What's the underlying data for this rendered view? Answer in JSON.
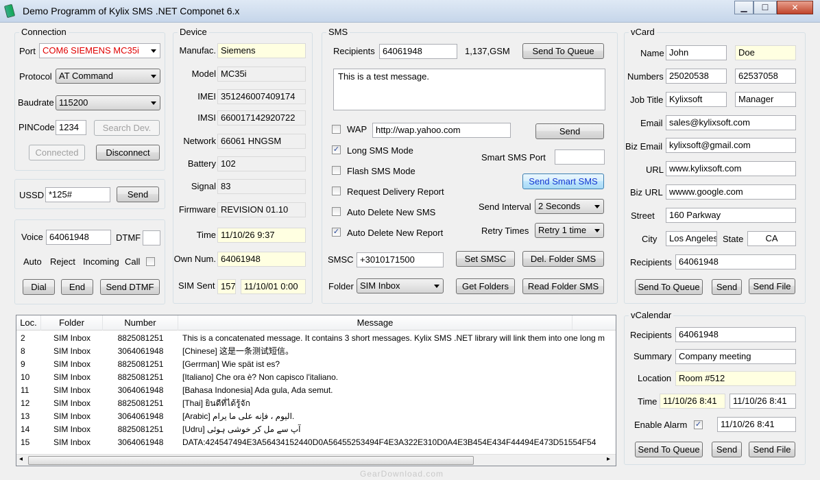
{
  "window": {
    "title": "Demo Programm of Kylix SMS .NET Componet  6.x"
  },
  "connection": {
    "group": "Connection",
    "port_label": "Port",
    "port_value": "COM6   SIEMENS MC35i",
    "protocol_label": "Protocol",
    "protocol_value": "AT Command",
    "baudrate_label": "Baudrate",
    "baudrate_value": "115200",
    "pincode_label": "PINCode",
    "pincode_value": "1234",
    "search_btn": "Search Dev.",
    "connected_btn": "Connected",
    "disconnect_btn": "Disconnect"
  },
  "ussd": {
    "label": "USSD",
    "value": "*125#",
    "send_btn": "Send"
  },
  "voice": {
    "label": "Voice",
    "value": "64061948",
    "dtmf_label": "DTMF",
    "dtmf_value": "",
    "auto": "Auto",
    "reject": "Reject",
    "incoming": "Incoming",
    "call": "Call",
    "dial_btn": "Dial",
    "end_btn": "End",
    "send_dtmf_btn": "Send DTMF"
  },
  "device": {
    "group": "Device",
    "rows": [
      {
        "label": "Manufac.",
        "value": "Siemens"
      },
      {
        "label": "Model",
        "value": "MC35i"
      },
      {
        "label": "IMEI",
        "value": "351246007409174"
      },
      {
        "label": "IMSI",
        "value": "660017142920722"
      },
      {
        "label": "Network",
        "value": "66061 HNGSM"
      },
      {
        "label": "Battery",
        "value": "102"
      },
      {
        "label": "Signal",
        "value": "83"
      },
      {
        "label": "Firmware",
        "value": "REVISION 01.10"
      },
      {
        "label": "Time",
        "value": "11/10/26 9:37"
      },
      {
        "label": "Own Num.",
        "value": "64061948"
      }
    ],
    "simsent_label": "SIM Sent",
    "simsent_count": "157",
    "simsent_time": "11/10/01 0:00"
  },
  "sms": {
    "group": "SMS",
    "recipients_label": "Recipients",
    "recipients_value": "64061948",
    "count": "1,137,GSM",
    "send_queue_btn": "Send To Queue",
    "message": "This is a test message.",
    "wap_label": "WAP",
    "wap_value": "http://wap.yahoo.com",
    "send_btn": "Send",
    "long_sms": "Long SMS Mode",
    "flash_sms": "Flash SMS Mode",
    "request_report": "Request Delivery Report",
    "auto_delete_sms": "Auto Delete New SMS",
    "auto_delete_report": "Auto Delete New Report",
    "smart_port_label": "Smart SMS Port",
    "smart_port_value": "",
    "send_smart_btn": "Send Smart SMS",
    "send_interval_label": "Send Interval",
    "send_interval_value": "2   Seconds",
    "retry_label": "Retry Times",
    "retry_value": "Retry 1 time",
    "smsc_label": "SMSC",
    "smsc_value": "+3010171500",
    "set_smsc_btn": "Set SMSC",
    "del_folder_btn": "Del. Folder SMS",
    "folder_label": "Folder",
    "folder_value": "SIM Inbox",
    "get_folders_btn": "Get Folders",
    "read_folder_btn": "Read Folder SMS"
  },
  "messages": {
    "columns": [
      "Loc.",
      "Folder",
      "Number",
      "Message"
    ],
    "rows": [
      {
        "loc": "2",
        "folder": "SIM Inbox",
        "number": "8825081251",
        "message": "This is a concatenated message. It contains 3 short messages. Kylix SMS .NET library will link them into one long m"
      },
      {
        "loc": "8",
        "folder": "SIM Inbox",
        "number": "3064061948",
        "message": "[Chinese] 这是一条测试短信。"
      },
      {
        "loc": "9",
        "folder": "SIM Inbox",
        "number": "8825081251",
        "message": "[Gerrman] Wie spät ist es?"
      },
      {
        "loc": "10",
        "folder": "SIM Inbox",
        "number": "8825081251",
        "message": "[Italiano] Che ora è? Non capisco l'italiano."
      },
      {
        "loc": "11",
        "folder": "SIM Inbox",
        "number": "3064061948",
        "message": "[Bahasa Indonesia] Ada gula, Ada semut."
      },
      {
        "loc": "12",
        "folder": "SIM Inbox",
        "number": "8825081251",
        "message": "[Thai] ยินดีที่ได้รู้จัก"
      },
      {
        "loc": "13",
        "folder": "SIM Inbox",
        "number": "3064061948",
        "message": "[Arabic] اليوم ، فإنه على ما يرام."
      },
      {
        "loc": "14",
        "folder": "SIM Inbox",
        "number": "8825081251",
        "message": "[Udru] آپ سے مل کر خوشی ہوئی"
      },
      {
        "loc": "15",
        "folder": "SIM Inbox",
        "number": "3064061948",
        "message": "DATA:424547494E3A56434152440D0A56455253494F4E3A322E310D0A4E3B454E434F44494E473D51554F54"
      }
    ]
  },
  "vcard": {
    "group": "vCard",
    "name_label": "Name",
    "first": "John",
    "last": "Doe",
    "numbers_label": "Numbers",
    "num1": "25020538",
    "num2": "62537058",
    "job_label": "Job Title",
    "company": "Kylixsoft",
    "title": "Manager",
    "email_label": "Email",
    "email": "sales@kylixsoft.com",
    "bizemail_label": "Biz Email",
    "bizemail": "kylixsoft@gmail.com",
    "url_label": "URL",
    "url": "www.kylixsoft.com",
    "bizurl_label": "Biz URL",
    "bizurl": "wwww.google.com",
    "street_label": "Street",
    "street": "160 Parkway",
    "city_label": "City",
    "city": "Los Angeles",
    "state_label": "State",
    "state": "CA",
    "recipients_label": "Recipients",
    "recipients": "64061948",
    "queue_btn": "Send To Queue",
    "send_btn": "Send",
    "file_btn": "Send File"
  },
  "vcalendar": {
    "group": "vCalendar",
    "recipients_label": "Recipients",
    "recipients": "64061948",
    "summary_label": "Summary",
    "summary": "Company meeting",
    "location_label": "Location",
    "location": "Room #512",
    "time_label": "Time",
    "time_start": "11/10/26 8:41",
    "time_end": "11/10/26 8:41",
    "alarm_label": "Enable Alarm",
    "alarm_time": "11/10/26 8:41",
    "queue_btn": "Send To Queue",
    "send_btn": "Send",
    "file_btn": "Send File"
  },
  "watermark": "GearDownload.com",
  "colors": {
    "highlight_input": "#ffffe1",
    "port_text": "#e00000",
    "smart_button_text": "#1437d1"
  }
}
